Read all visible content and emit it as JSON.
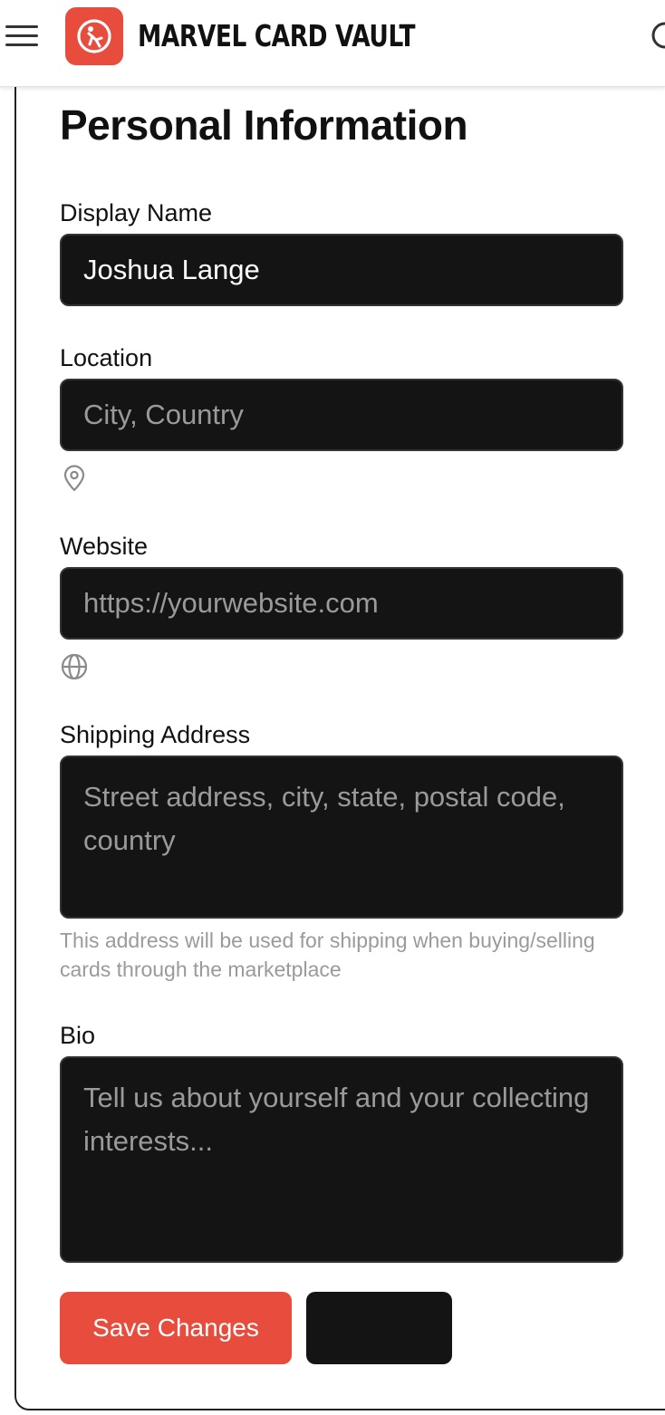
{
  "header": {
    "brand": "MARVEL CARD VAULT",
    "menu_icon": "hamburger-menu-icon",
    "logo_icon": "flying-hero-logo-icon",
    "search_icon": "search-icon",
    "accent_color": "#e84c3d"
  },
  "form": {
    "title": "Personal Information",
    "display_name": {
      "label": "Display Name",
      "value": "Joshua Lange"
    },
    "location": {
      "label": "Location",
      "placeholder": "City, Country",
      "icon": "map-pin-icon"
    },
    "website": {
      "label": "Website",
      "placeholder": "https://yourwebsite.com",
      "icon": "globe-icon"
    },
    "shipping_address": {
      "label": "Shipping Address",
      "placeholder": "Street address, city, state, postal code, country",
      "helper": "This address will be used for shipping when buying/selling cards through the marketplace"
    },
    "bio": {
      "label": "Bio",
      "placeholder": "Tell us about yourself and your collecting interests..."
    }
  },
  "actions": {
    "save_label": "Save Changes",
    "secondary_label": ""
  }
}
